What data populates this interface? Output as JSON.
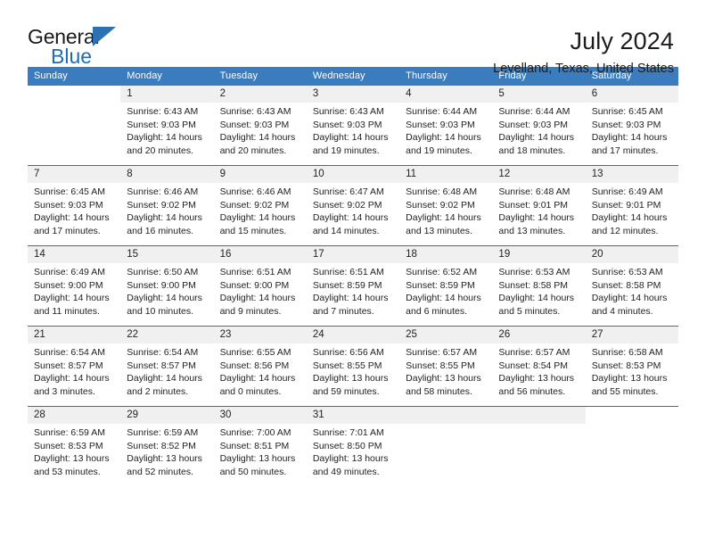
{
  "brand": {
    "name_top": "General",
    "name_bottom": "Blue",
    "accent_color": "#2b72b5"
  },
  "header": {
    "title": "July 2024",
    "subtitle": "Levelland, Texas, United States"
  },
  "theme": {
    "header_bg": "#3a7cbe",
    "row_divider": "#2f6fac",
    "daynum_band": "#f0f0f0"
  },
  "weekdays": [
    "Sunday",
    "Monday",
    "Tuesday",
    "Wednesday",
    "Thursday",
    "Friday",
    "Saturday"
  ],
  "labels": {
    "sunrise_prefix": "Sunrise:",
    "sunset_prefix": "Sunset:",
    "daylight_prefix": "Daylight:"
  },
  "weeks": [
    [
      {
        "day": "",
        "line1": "",
        "line2": "",
        "line3": "",
        "line4": "",
        "blank": true
      },
      {
        "day": "1",
        "line1": "Sunrise: 6:43 AM",
        "line2": "Sunset: 9:03 PM",
        "line3": "Daylight: 14 hours",
        "line4": "and 20 minutes."
      },
      {
        "day": "2",
        "line1": "Sunrise: 6:43 AM",
        "line2": "Sunset: 9:03 PM",
        "line3": "Daylight: 14 hours",
        "line4": "and 20 minutes."
      },
      {
        "day": "3",
        "line1": "Sunrise: 6:43 AM",
        "line2": "Sunset: 9:03 PM",
        "line3": "Daylight: 14 hours",
        "line4": "and 19 minutes."
      },
      {
        "day": "4",
        "line1": "Sunrise: 6:44 AM",
        "line2": "Sunset: 9:03 PM",
        "line3": "Daylight: 14 hours",
        "line4": "and 19 minutes."
      },
      {
        "day": "5",
        "line1": "Sunrise: 6:44 AM",
        "line2": "Sunset: 9:03 PM",
        "line3": "Daylight: 14 hours",
        "line4": "and 18 minutes."
      },
      {
        "day": "6",
        "line1": "Sunrise: 6:45 AM",
        "line2": "Sunset: 9:03 PM",
        "line3": "Daylight: 14 hours",
        "line4": "and 17 minutes."
      }
    ],
    [
      {
        "day": "7",
        "line1": "Sunrise: 6:45 AM",
        "line2": "Sunset: 9:03 PM",
        "line3": "Daylight: 14 hours",
        "line4": "and 17 minutes."
      },
      {
        "day": "8",
        "line1": "Sunrise: 6:46 AM",
        "line2": "Sunset: 9:02 PM",
        "line3": "Daylight: 14 hours",
        "line4": "and 16 minutes."
      },
      {
        "day": "9",
        "line1": "Sunrise: 6:46 AM",
        "line2": "Sunset: 9:02 PM",
        "line3": "Daylight: 14 hours",
        "line4": "and 15 minutes."
      },
      {
        "day": "10",
        "line1": "Sunrise: 6:47 AM",
        "line2": "Sunset: 9:02 PM",
        "line3": "Daylight: 14 hours",
        "line4": "and 14 minutes."
      },
      {
        "day": "11",
        "line1": "Sunrise: 6:48 AM",
        "line2": "Sunset: 9:02 PM",
        "line3": "Daylight: 14 hours",
        "line4": "and 13 minutes."
      },
      {
        "day": "12",
        "line1": "Sunrise: 6:48 AM",
        "line2": "Sunset: 9:01 PM",
        "line3": "Daylight: 14 hours",
        "line4": "and 13 minutes."
      },
      {
        "day": "13",
        "line1": "Sunrise: 6:49 AM",
        "line2": "Sunset: 9:01 PM",
        "line3": "Daylight: 14 hours",
        "line4": "and 12 minutes."
      }
    ],
    [
      {
        "day": "14",
        "line1": "Sunrise: 6:49 AM",
        "line2": "Sunset: 9:00 PM",
        "line3": "Daylight: 14 hours",
        "line4": "and 11 minutes."
      },
      {
        "day": "15",
        "line1": "Sunrise: 6:50 AM",
        "line2": "Sunset: 9:00 PM",
        "line3": "Daylight: 14 hours",
        "line4": "and 10 minutes."
      },
      {
        "day": "16",
        "line1": "Sunrise: 6:51 AM",
        "line2": "Sunset: 9:00 PM",
        "line3": "Daylight: 14 hours",
        "line4": "and 9 minutes."
      },
      {
        "day": "17",
        "line1": "Sunrise: 6:51 AM",
        "line2": "Sunset: 8:59 PM",
        "line3": "Daylight: 14 hours",
        "line4": "and 7 minutes."
      },
      {
        "day": "18",
        "line1": "Sunrise: 6:52 AM",
        "line2": "Sunset: 8:59 PM",
        "line3": "Daylight: 14 hours",
        "line4": "and 6 minutes."
      },
      {
        "day": "19",
        "line1": "Sunrise: 6:53 AM",
        "line2": "Sunset: 8:58 PM",
        "line3": "Daylight: 14 hours",
        "line4": "and 5 minutes."
      },
      {
        "day": "20",
        "line1": "Sunrise: 6:53 AM",
        "line2": "Sunset: 8:58 PM",
        "line3": "Daylight: 14 hours",
        "line4": "and 4 minutes."
      }
    ],
    [
      {
        "day": "21",
        "line1": "Sunrise: 6:54 AM",
        "line2": "Sunset: 8:57 PM",
        "line3": "Daylight: 14 hours",
        "line4": "and 3 minutes."
      },
      {
        "day": "22",
        "line1": "Sunrise: 6:54 AM",
        "line2": "Sunset: 8:57 PM",
        "line3": "Daylight: 14 hours",
        "line4": "and 2 minutes."
      },
      {
        "day": "23",
        "line1": "Sunrise: 6:55 AM",
        "line2": "Sunset: 8:56 PM",
        "line3": "Daylight: 14 hours",
        "line4": "and 0 minutes."
      },
      {
        "day": "24",
        "line1": "Sunrise: 6:56 AM",
        "line2": "Sunset: 8:55 PM",
        "line3": "Daylight: 13 hours",
        "line4": "and 59 minutes."
      },
      {
        "day": "25",
        "line1": "Sunrise: 6:57 AM",
        "line2": "Sunset: 8:55 PM",
        "line3": "Daylight: 13 hours",
        "line4": "and 58 minutes."
      },
      {
        "day": "26",
        "line1": "Sunrise: 6:57 AM",
        "line2": "Sunset: 8:54 PM",
        "line3": "Daylight: 13 hours",
        "line4": "and 56 minutes."
      },
      {
        "day": "27",
        "line1": "Sunrise: 6:58 AM",
        "line2": "Sunset: 8:53 PM",
        "line3": "Daylight: 13 hours",
        "line4": "and 55 minutes."
      }
    ],
    [
      {
        "day": "28",
        "line1": "Sunrise: 6:59 AM",
        "line2": "Sunset: 8:53 PM",
        "line3": "Daylight: 13 hours",
        "line4": "and 53 minutes."
      },
      {
        "day": "29",
        "line1": "Sunrise: 6:59 AM",
        "line2": "Sunset: 8:52 PM",
        "line3": "Daylight: 13 hours",
        "line4": "and 52 minutes."
      },
      {
        "day": "30",
        "line1": "Sunrise: 7:00 AM",
        "line2": "Sunset: 8:51 PM",
        "line3": "Daylight: 13 hours",
        "line4": "and 50 minutes."
      },
      {
        "day": "31",
        "line1": "Sunrise: 7:01 AM",
        "line2": "Sunset: 8:50 PM",
        "line3": "Daylight: 13 hours",
        "line4": "and 49 minutes."
      },
      {
        "day": "",
        "line1": "",
        "line2": "",
        "line3": "",
        "line4": "",
        "blank": false
      },
      {
        "day": "",
        "line1": "",
        "line2": "",
        "line3": "",
        "line4": "",
        "blank": false
      },
      {
        "day": "",
        "line1": "",
        "line2": "",
        "line3": "",
        "line4": "",
        "blank": true
      }
    ]
  ]
}
